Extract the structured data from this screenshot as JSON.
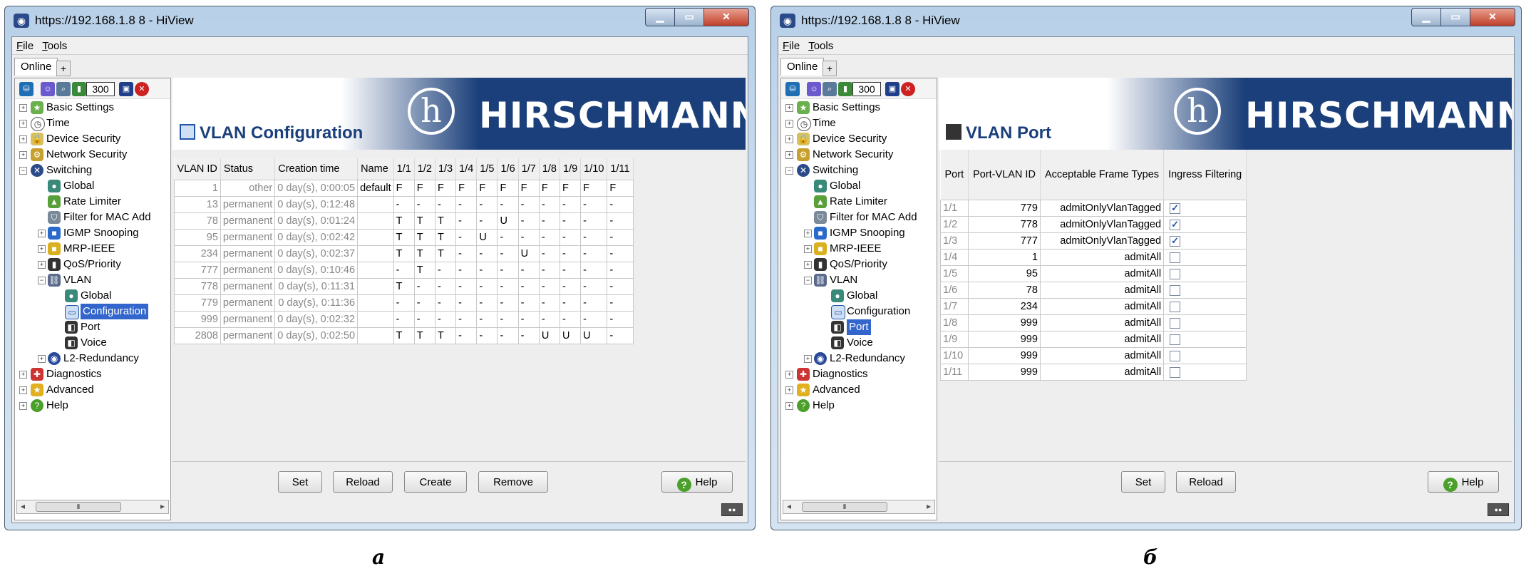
{
  "windows": [
    {
      "title": "https://192.168.1.8 8 - HiView",
      "menu": [
        "File",
        "Tools"
      ],
      "tab": "Online",
      "toolbar_counter": "300",
      "tree": [
        {
          "label": "Basic Settings"
        },
        {
          "label": "Time"
        },
        {
          "label": "Device Security"
        },
        {
          "label": "Network Security"
        },
        {
          "label": "Switching"
        },
        {
          "label": "Global"
        },
        {
          "label": "Rate Limiter"
        },
        {
          "label": "Filter for MAC Add"
        },
        {
          "label": "IGMP Snooping"
        },
        {
          "label": "MRP-IEEE"
        },
        {
          "label": "QoS/Priority"
        },
        {
          "label": "VLAN"
        },
        {
          "label": "Global"
        },
        {
          "label": "Configuration"
        },
        {
          "label": "Port"
        },
        {
          "label": "Voice"
        },
        {
          "label": "L2-Redundancy"
        },
        {
          "label": "Diagnostics"
        },
        {
          "label": "Advanced"
        },
        {
          "label": "Help"
        }
      ],
      "brand": "HIRSCHMANN",
      "page_title": "VLAN Configuration",
      "buttons": [
        "Set",
        "Reload",
        "Create",
        "Remove"
      ],
      "help_label": "Help"
    },
    {
      "title": "https://192.168.1.8 8 - HiView",
      "menu": [
        "File",
        "Tools"
      ],
      "tab": "Online",
      "toolbar_counter": "300",
      "tree": [
        {
          "label": "Basic Settings"
        },
        {
          "label": "Time"
        },
        {
          "label": "Device Security"
        },
        {
          "label": "Network Security"
        },
        {
          "label": "Switching"
        },
        {
          "label": "Global"
        },
        {
          "label": "Rate Limiter"
        },
        {
          "label": "Filter for MAC Add"
        },
        {
          "label": "IGMP Snooping"
        },
        {
          "label": "MRP-IEEE"
        },
        {
          "label": "QoS/Priority"
        },
        {
          "label": "VLAN"
        },
        {
          "label": "Global"
        },
        {
          "label": "Configuration"
        },
        {
          "label": "Port"
        },
        {
          "label": "Voice"
        },
        {
          "label": "L2-Redundancy"
        },
        {
          "label": "Diagnostics"
        },
        {
          "label": "Advanced"
        },
        {
          "label": "Help"
        }
      ],
      "brand": "HIRSCHMANN",
      "page_title": "VLAN Port",
      "buttons": [
        "Set",
        "Reload"
      ],
      "help_label": "Help"
    }
  ],
  "vlan_table": {
    "headers": [
      "VLAN ID",
      "Status",
      "Creation time",
      "Name",
      "1/1",
      "1/2",
      "1/3",
      "1/4",
      "1/5",
      "1/6",
      "1/7",
      "1/8",
      "1/9",
      "1/10",
      "1/11"
    ],
    "rows": [
      [
        "1",
        "other",
        "0 day(s), 0:00:05",
        "default",
        "F",
        "F",
        "F",
        "F",
        "F",
        "F",
        "F",
        "F",
        "F",
        "F",
        "F"
      ],
      [
        "13",
        "permanent",
        "0 day(s), 0:12:48",
        "",
        "-",
        "-",
        "-",
        "-",
        "-",
        "-",
        "-",
        "-",
        "-",
        "-",
        "-"
      ],
      [
        "78",
        "permanent",
        "0 day(s), 0:01:24",
        "",
        "T",
        "T",
        "T",
        "-",
        "-",
        "U",
        "-",
        "-",
        "-",
        "-",
        "-"
      ],
      [
        "95",
        "permanent",
        "0 day(s), 0:02:42",
        "",
        "T",
        "T",
        "T",
        "-",
        "U",
        "-",
        "-",
        "-",
        "-",
        "-",
        "-"
      ],
      [
        "234",
        "permanent",
        "0 day(s), 0:02:37",
        "",
        "T",
        "T",
        "T",
        "-",
        "-",
        "-",
        "U",
        "-",
        "-",
        "-",
        "-"
      ],
      [
        "777",
        "permanent",
        "0 day(s), 0:10:46",
        "",
        "-",
        "T",
        "-",
        "-",
        "-",
        "-",
        "-",
        "-",
        "-",
        "-",
        "-"
      ],
      [
        "778",
        "permanent",
        "0 day(s), 0:11:31",
        "",
        "T",
        "-",
        "-",
        "-",
        "-",
        "-",
        "-",
        "-",
        "-",
        "-",
        "-"
      ],
      [
        "779",
        "permanent",
        "0 day(s), 0:11:36",
        "",
        "-",
        "-",
        "-",
        "-",
        "-",
        "-",
        "-",
        "-",
        "-",
        "-",
        "-"
      ],
      [
        "999",
        "permanent",
        "0 day(s), 0:02:32",
        "",
        "-",
        "-",
        "-",
        "-",
        "-",
        "-",
        "-",
        "-",
        "-",
        "-",
        "-"
      ],
      [
        "2808",
        "permanent",
        "0 day(s), 0:02:50",
        "",
        "T",
        "T",
        "T",
        "-",
        "-",
        "-",
        "-",
        "U",
        "U",
        "U",
        "-"
      ]
    ]
  },
  "port_table": {
    "headers": [
      "Port",
      "Port-VLAN ID",
      "Acceptable Frame Types",
      "Ingress Filtering"
    ],
    "rows": [
      {
        "port": "1/1",
        "pvid": "779",
        "frame": "admitOnlyVlanTagged",
        "ingress": true
      },
      {
        "port": "1/2",
        "pvid": "778",
        "frame": "admitOnlyVlanTagged",
        "ingress": true
      },
      {
        "port": "1/3",
        "pvid": "777",
        "frame": "admitOnlyVlanTagged",
        "ingress": true
      },
      {
        "port": "1/4",
        "pvid": "1",
        "frame": "admitAll",
        "ingress": false
      },
      {
        "port": "1/5",
        "pvid": "95",
        "frame": "admitAll",
        "ingress": false
      },
      {
        "port": "1/6",
        "pvid": "78",
        "frame": "admitAll",
        "ingress": false
      },
      {
        "port": "1/7",
        "pvid": "234",
        "frame": "admitAll",
        "ingress": false
      },
      {
        "port": "1/8",
        "pvid": "999",
        "frame": "admitAll",
        "ingress": false
      },
      {
        "port": "1/9",
        "pvid": "999",
        "frame": "admitAll",
        "ingress": false
      },
      {
        "port": "1/10",
        "pvid": "999",
        "frame": "admitAll",
        "ingress": false
      },
      {
        "port": "1/11",
        "pvid": "999",
        "frame": "admitAll",
        "ingress": false
      }
    ]
  },
  "captions": [
    "а",
    "б"
  ],
  "colors": {
    "brand_blue": "#1a3f7a",
    "selection": "#3366cc",
    "tree_star": "#4aa02a"
  }
}
